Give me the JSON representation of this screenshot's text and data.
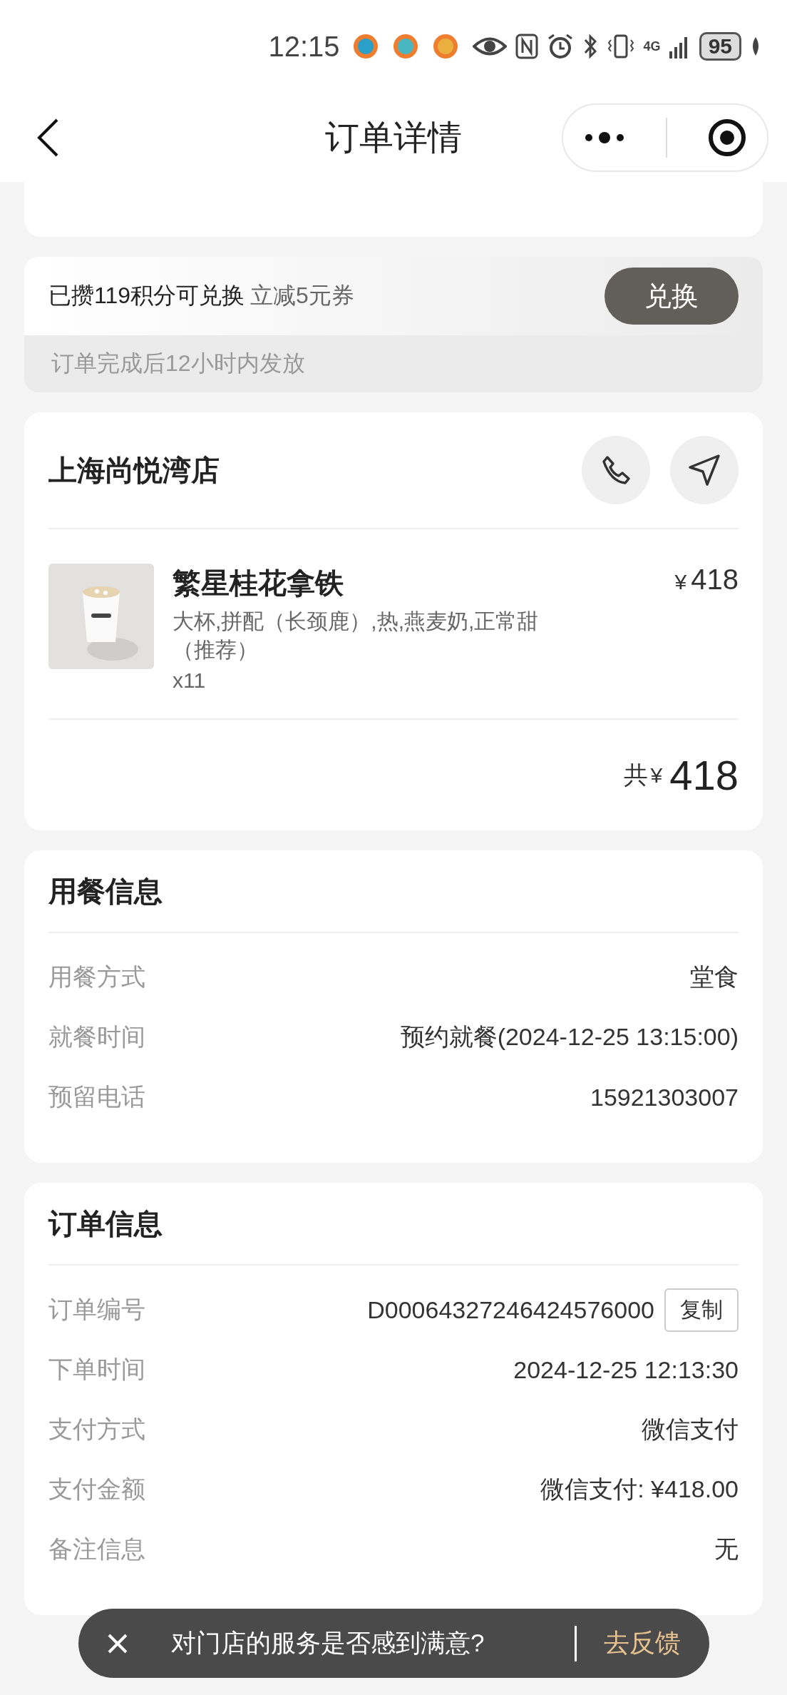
{
  "status_bar": {
    "time": "12:15",
    "network": "4G",
    "battery": "95"
  },
  "nav": {
    "title": "订单详情"
  },
  "points": {
    "text": "已攒119积分可兑换",
    "reward": "立减5元券",
    "button": "兑换",
    "note": "订单完成后12小时内发放"
  },
  "store": {
    "name": "上海尚悦湾店",
    "items": [
      {
        "name": "繁星桂花拿铁",
        "options": "大杯,拼配（长颈鹿）,热,燕麦奶,正常甜（推荐）",
        "quantity": "x11",
        "currency": "¥",
        "price": "418"
      }
    ],
    "total_label": "共",
    "total_currency": "¥",
    "total": "418"
  },
  "dining": {
    "title": "用餐信息",
    "rows": [
      {
        "label": "用餐方式",
        "value": "堂食"
      },
      {
        "label": "就餐时间",
        "value": "预约就餐(2024-12-25 13:15:00)"
      },
      {
        "label": "预留电话",
        "value": "15921303007"
      }
    ]
  },
  "order": {
    "title": "订单信息",
    "rows": [
      {
        "label": "订单编号",
        "value": "D00064327246424576000",
        "action": "复制"
      },
      {
        "label": "下单时间",
        "value": "2024-12-25 12:13:30"
      },
      {
        "label": "支付方式",
        "value": "微信支付"
      },
      {
        "label": "支付金额",
        "value": "微信支付: ¥418.00"
      },
      {
        "label": "备注信息",
        "value": "无"
      }
    ]
  },
  "toast": {
    "message": "对门店的服务是否感到满意?",
    "action": "去反馈"
  }
}
